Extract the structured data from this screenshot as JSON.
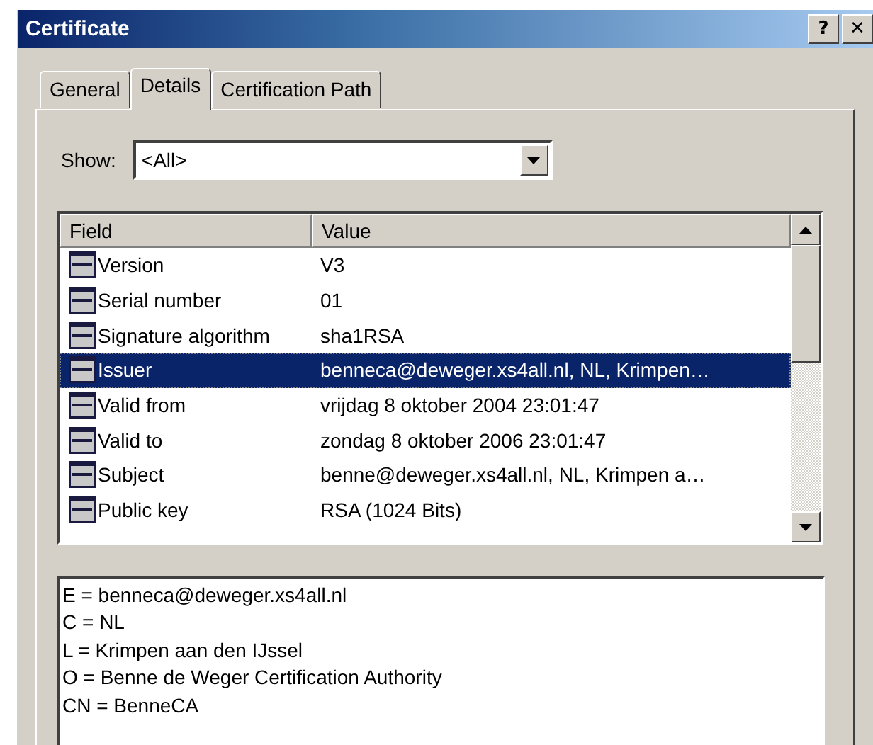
{
  "window": {
    "title": "Certificate",
    "buttons": [
      "?",
      "✕"
    ]
  },
  "tabs": [
    {
      "label": "General",
      "selected": false
    },
    {
      "label": "Details",
      "selected": true
    },
    {
      "label": "Certification Path",
      "selected": false
    }
  ],
  "show": {
    "label": "Show:",
    "value": "<All>"
  },
  "table": {
    "columns": [
      "Field",
      "Value"
    ],
    "rows": [
      {
        "field": "Version",
        "value": "V3",
        "selected": false
      },
      {
        "field": "Serial number",
        "value": "01",
        "selected": false
      },
      {
        "field": "Signature algorithm",
        "value": "sha1RSA",
        "selected": false
      },
      {
        "field": "Issuer",
        "value": "benneca@deweger.xs4all.nl, NL, Krimpen…",
        "selected": true
      },
      {
        "field": "Valid from",
        "value": "vrijdag 8 oktober 2004 23:01:47",
        "selected": false
      },
      {
        "field": "Valid to",
        "value": "zondag 8 oktober 2006 23:01:47",
        "selected": false
      },
      {
        "field": "Subject",
        "value": "benne@deweger.xs4all.nl, NL, Krimpen a…",
        "selected": false
      },
      {
        "field": "Public key",
        "value": "RSA (1024 Bits)",
        "selected": false
      }
    ]
  },
  "detail_lines": [
    "E = benneca@deweger.xs4all.nl",
    "C = NL",
    "L = Krimpen aan den IJssel",
    "O = Benne de Weger Certification Authority",
    "CN = BenneCA"
  ]
}
